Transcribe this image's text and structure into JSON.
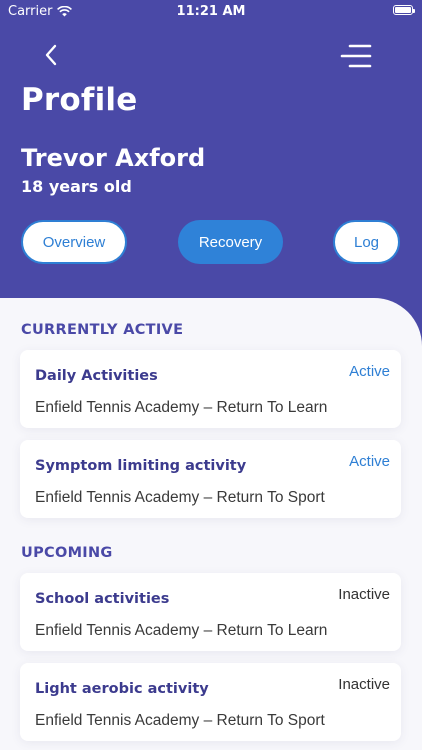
{
  "status_bar": {
    "carrier": "Carrier",
    "time": "11:21 AM"
  },
  "header": {
    "title": "Profile",
    "user_name": "Trevor Axford",
    "user_age": "18 years old"
  },
  "tabs": [
    {
      "label": "Overview",
      "selected": false
    },
    {
      "label": "Recovery",
      "selected": true
    },
    {
      "label": "Log",
      "selected": false
    }
  ],
  "sections": {
    "currently_active": {
      "title": "CURRENTLY ACTIVE",
      "items": [
        {
          "title": "Daily Activities",
          "subtitle": "Enfield Tennis Academy – Return To Learn",
          "status": "Active"
        },
        {
          "title": "Symptom limiting activity",
          "subtitle": "Enfield Tennis Academy – Return To Sport",
          "status": "Active"
        }
      ]
    },
    "upcoming": {
      "title": "UPCOMING",
      "items": [
        {
          "title": "School activities",
          "subtitle": "Enfield Tennis Academy – Return To Learn",
          "status": "Inactive"
        },
        {
          "title": "Light aerobic activity",
          "subtitle": "Enfield Tennis Academy – Return To Sport",
          "status": "Inactive"
        }
      ]
    }
  },
  "colors": {
    "header_bg": "#4a49a7",
    "accent": "#2e7fd4",
    "content_bg": "#f7f7fb",
    "title_text": "#3c3b8e"
  },
  "icons": {
    "back": "chevron-left-icon",
    "menu": "menu-icon",
    "wifi": "wifi-icon",
    "battery": "battery-icon"
  }
}
